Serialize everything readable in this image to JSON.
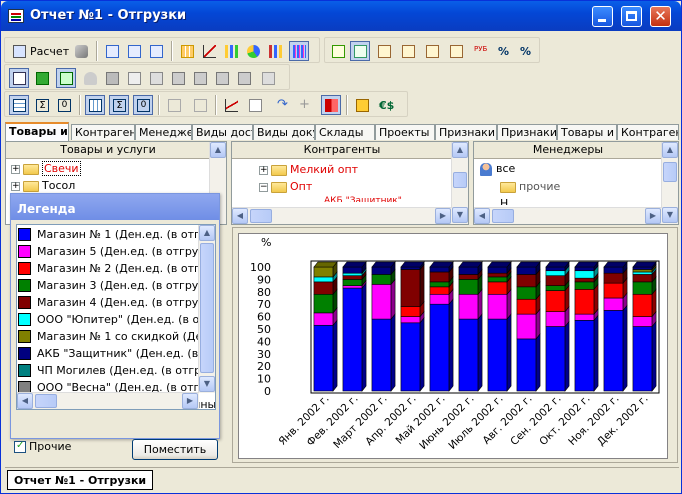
{
  "window": {
    "title": "Отчет №1 - Отгрузки",
    "app_icon": "report-icon"
  },
  "toolbar1": {
    "calc_label": "Расчет"
  },
  "tabs": [
    {
      "label": "Товары и"
    },
    {
      "label": "Контрагент"
    },
    {
      "label": "Менеджеры"
    },
    {
      "label": "Виды доста"
    },
    {
      "label": "Виды доку"
    },
    {
      "label": "Склады"
    },
    {
      "label": "Проекты"
    },
    {
      "label": "Признаки"
    },
    {
      "label": "Признаки ("
    },
    {
      "label": "Товары и у"
    },
    {
      "label": "Контрагент"
    }
  ],
  "panels": {
    "goods": {
      "title": "Товары и услуги",
      "items": [
        "Свечи",
        "Тосол"
      ]
    },
    "contractors": {
      "title": "Контрагенты",
      "items": [
        "Мелкий опт",
        "Опт",
        "АКБ \"Защитник\""
      ]
    },
    "managers": {
      "title": "Менеджеры",
      "items": [
        "все",
        "прочие",
        "Н"
      ]
    }
  },
  "legend": {
    "title": "Легенда",
    "items": [
      {
        "label": "Магазин № 1 (Ден.ед. (в отгрузочных",
        "color": "#0000ff"
      },
      {
        "label": "Магазин 5 (Ден.ед. (в отгрузочных",
        "color": "#ff00ff"
      },
      {
        "label": "Магазин № 2 (Ден.ед. (в отгрузочны",
        "color": "#ff0000"
      },
      {
        "label": "Магазин 3 (Ден.ед. (в отгрузочных",
        "color": "#008000"
      },
      {
        "label": "Магазин 4 (Ден.ед. (в отгрузочных",
        "color": "#800000"
      },
      {
        "label": "ООО \"Юпитер\" (Ден.ед. (в отгрузоч",
        "color": "#00ffff"
      },
      {
        "label": "Магазин № 1 со скидкой (Ден.ед. (в",
        "color": "#808000"
      },
      {
        "label": "АКБ \"Защитник\" (Ден.ед. (в отгрузо",
        "color": "#000080"
      },
      {
        "label": "ЧП Могилев (Ден.ед. (в отгрузочны",
        "color": "#008080"
      },
      {
        "label": "ООО \"Весна\" (Ден.ед. (в отгрузочны",
        "color": "#808080"
      },
      {
        "label": "Прочие (Ден.ед. (в отгрузочных цен",
        "color": "#800080"
      }
    ],
    "checkbox_label": "Прочие",
    "place_button": "Поместить"
  },
  "status": {
    "report_label": "Отчет №1 - Отгрузки"
  },
  "chart_data": {
    "type": "bar",
    "stacked": true,
    "ylabel": "%",
    "ylim": [
      0,
      100
    ],
    "yticks": [
      "0",
      "10",
      "20",
      "30",
      "40",
      "50",
      "60",
      "70",
      "80",
      "90",
      "100"
    ],
    "categories": [
      "Янв. 2002 г.",
      "Фев. 2002 г.",
      "Март 2002 г.",
      "Апр. 2002 г.",
      "Май 2002 г.",
      "Июнь 2002 г.",
      "Июль 2002 г.",
      "Авг. 2002 г.",
      "Сен. 2002 г.",
      "Окт. 2002 г.",
      "Ноя. 2002 г.",
      "Дек. 2002 г."
    ],
    "series": [
      {
        "color": "#0000ff",
        "values": [
          53,
          83,
          58,
          55,
          70,
          58,
          58,
          42,
          52,
          57,
          65,
          52
        ]
      },
      {
        "color": "#ff00ff",
        "values": [
          10,
          2,
          28,
          5,
          8,
          20,
          20,
          20,
          12,
          5,
          10,
          8
        ]
      },
      {
        "color": "#ff0000",
        "values": [
          0,
          0,
          0,
          8,
          6,
          0,
          10,
          12,
          17,
          20,
          12,
          18
        ]
      },
      {
        "color": "#008000",
        "values": [
          15,
          5,
          8,
          0,
          4,
          12,
          4,
          10,
          4,
          6,
          0,
          10
        ]
      },
      {
        "color": "#800000",
        "values": [
          10,
          3,
          0,
          30,
          8,
          4,
          3,
          10,
          8,
          3,
          8,
          6
        ]
      },
      {
        "color": "#00ffff",
        "values": [
          4,
          2,
          0,
          0,
          0,
          0,
          0,
          0,
          4,
          6,
          0,
          2
        ]
      },
      {
        "color": "#808000",
        "values": [
          8,
          0,
          0,
          0,
          0,
          0,
          0,
          0,
          0,
          0,
          0,
          2
        ]
      },
      {
        "color": "#000080",
        "values": [
          0,
          5,
          6,
          2,
          4,
          6,
          5,
          6,
          3,
          3,
          5,
          2
        ]
      }
    ]
  }
}
